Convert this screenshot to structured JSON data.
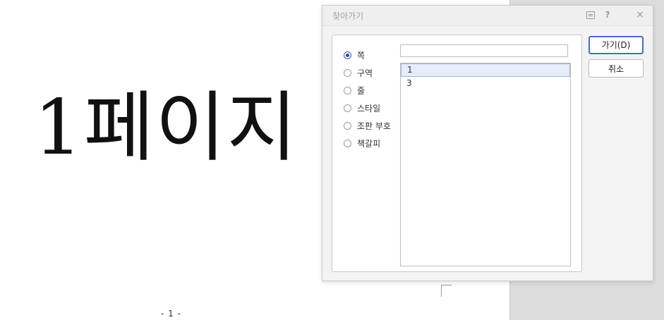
{
  "document": {
    "big_text": "1페이지",
    "page_number": "- 1 -"
  },
  "dialog": {
    "title": "찾아가기",
    "help_label": "?",
    "close_label": "×",
    "radio_options": [
      {
        "label": "쪽",
        "checked": true
      },
      {
        "label": "구역",
        "checked": false
      },
      {
        "label": "줄",
        "checked": false
      },
      {
        "label": "스타일",
        "checked": false
      },
      {
        "label": "조판 부호",
        "checked": false
      },
      {
        "label": "책갈피",
        "checked": false
      }
    ],
    "input_value": "",
    "list_items": [
      {
        "label": "1",
        "selected": true
      },
      {
        "label": "3",
        "selected": false
      }
    ],
    "go_button": "가기(D)",
    "cancel_button": "취소"
  }
}
